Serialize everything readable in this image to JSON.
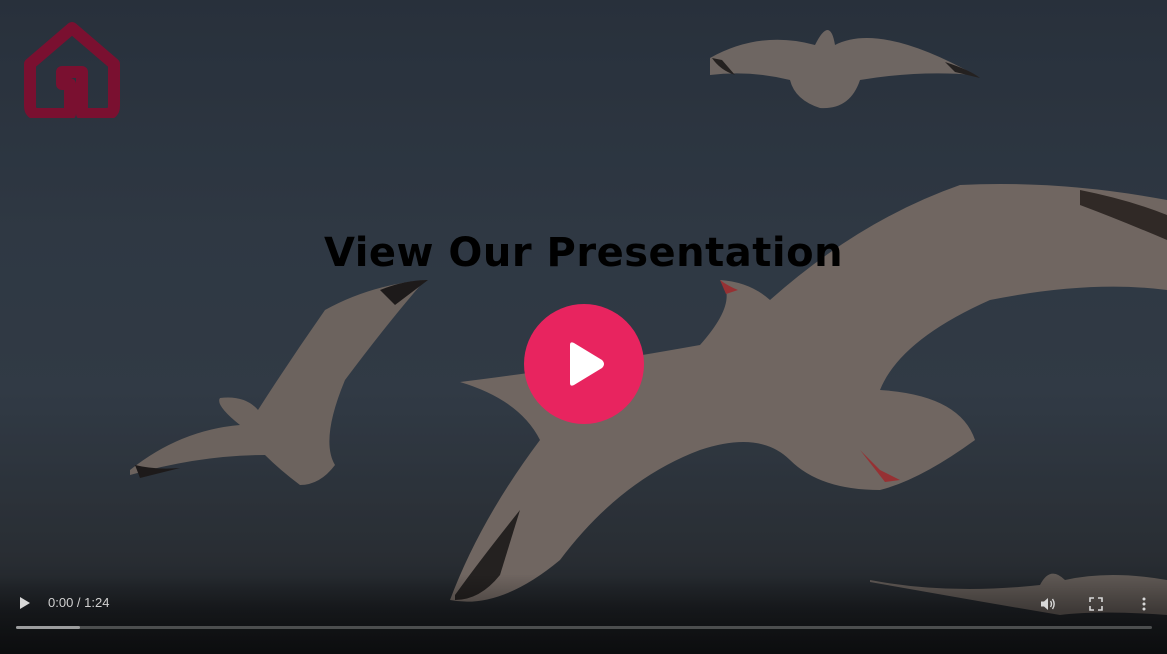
{
  "presentation": {
    "headline": "View Our Presentation"
  },
  "video": {
    "current_time": "0:00",
    "duration": "1:24",
    "time_display": "0:00 / 1:24",
    "buffered_fraction": 0.056,
    "state": "paused"
  },
  "icons": {
    "logo": "house-logo-icon",
    "big_play": "play-icon",
    "control_play": "play-icon",
    "volume": "volume-icon",
    "fullscreen": "fullscreen-icon",
    "more": "more-options-icon"
  },
  "colors": {
    "accent": "#e8245f",
    "logo": "#7a1030",
    "sky": "#36414d"
  }
}
